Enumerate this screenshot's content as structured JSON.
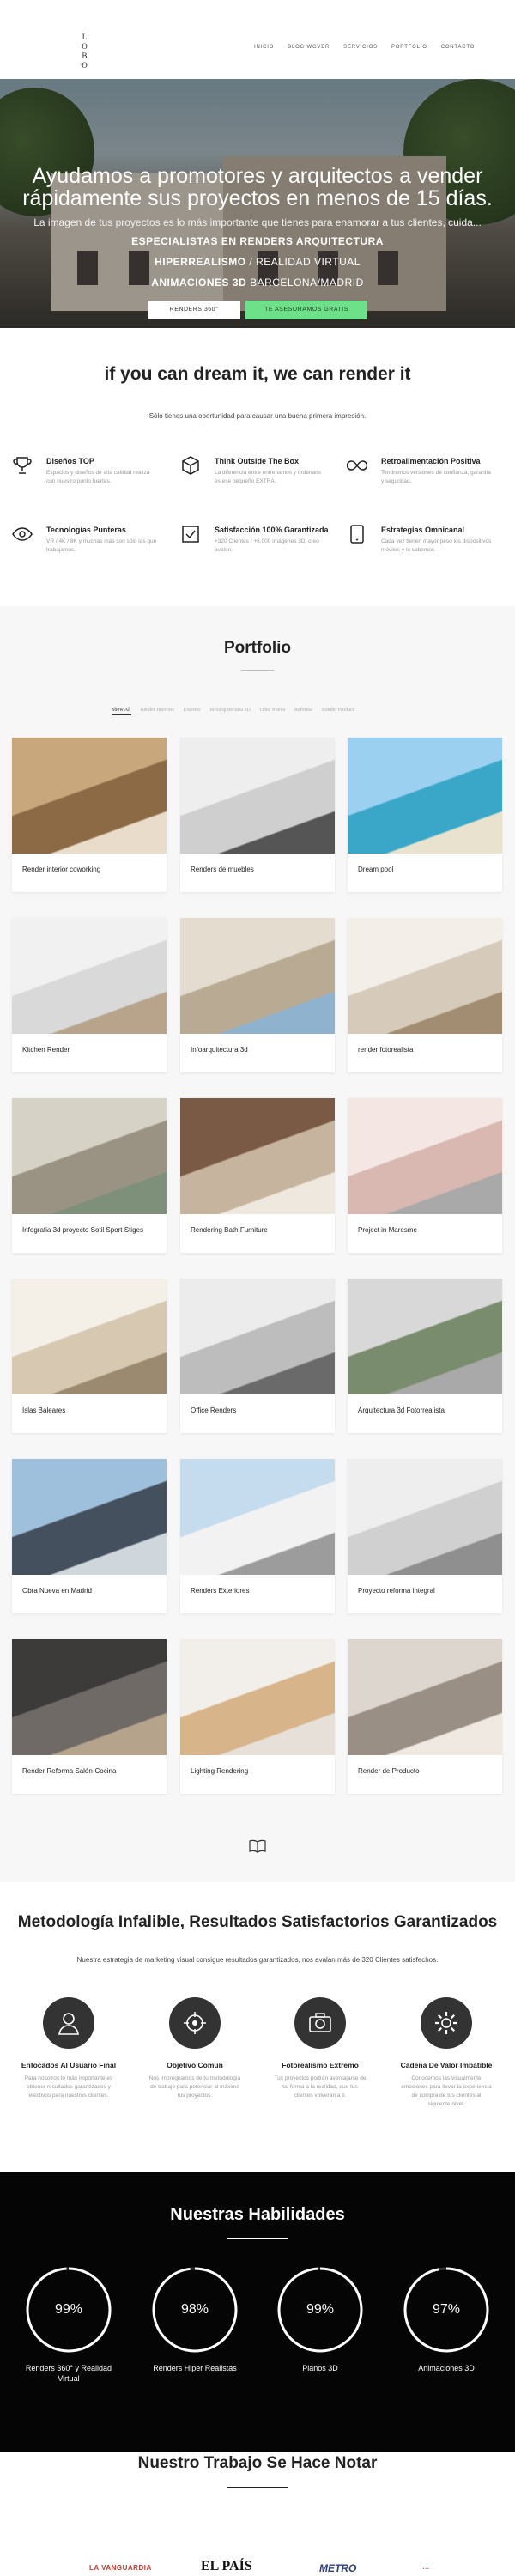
{
  "header": {
    "logo_line1": "L O",
    "logo_line2": "B O",
    "logo_sub": "3D",
    "nav": [
      "INICIO",
      "BLOG WGVER",
      "SERVICIOS",
      "PORTFOLIO",
      "CONTACTO"
    ]
  },
  "hero": {
    "title_line1": "Ayudamos a promotores y arquitectos a vender",
    "title_line2": "rápidamente sus proyectos en menos de 15 días.",
    "subtitle": "La imagen de tus proyectos es lo más importante que tienes para enamorar a tus clientes, cuida...",
    "highlight1": "ESPECIALISTAS EN RENDERS ARQUITECTURA",
    "highlight2_bold": "HIPERREALISMO",
    "highlight2_rest": " / REALIDAD VIRTUAL",
    "highlight3_bold": "ANIMACIONES 3D",
    "highlight3_rest": "  BARCELONA/MADRID",
    "btn_primary": "RENDERS 360°",
    "btn_secondary": "TE ASESORAMOS GRATIS"
  },
  "dream": {
    "title": "if you can dream it, we can render it",
    "subtitle": "Sólo tienes una oportunidad para causar una buena primera impresión.",
    "features": [
      {
        "icon": "trophy-icon",
        "title": "Diseños TOP",
        "desc": "Espacios y diseños de alta calidad realiza con nuestro punto fuertes."
      },
      {
        "icon": "cube-icon",
        "title": "Think Outside The Box",
        "desc": "La diferencia entre entrenamos y ordenaris es ese pequeño EXTRA."
      },
      {
        "icon": "infinity-icon",
        "title": "Retroalimentación Positiva",
        "desc": "Tendremos versiones de confianza, garantía y seguridad."
      },
      {
        "icon": "eye-icon",
        "title": "Tecnologías Punteras",
        "desc": "VR / 4K / 8K y muchas más son sólo las que trabajamos."
      },
      {
        "icon": "check-icon",
        "title": "Satisfacción 100% Garantizada",
        "desc": "+320 Clientes / +6.000 imágenes 3D, creo avalan."
      },
      {
        "icon": "tablet-icon",
        "title": "Estrategias Omnicanal",
        "desc": "Cada vez tienen mayor peso los dispositivos móviles y lo sabemos."
      }
    ]
  },
  "portfolio": {
    "title": "Portfolio",
    "filters": [
      "Show All",
      "Render Interiors",
      "Exterior",
      "Infoarquitectura 3D",
      "Obra Nueva",
      "Reforma",
      "Render Product"
    ],
    "items": [
      {
        "caption": "Render interior coworking",
        "theme": "wood"
      },
      {
        "caption": "Renders de muebles",
        "theme": "office-white"
      },
      {
        "caption": "Dream pool",
        "theme": "pool"
      },
      {
        "caption": "Kitchen Render",
        "theme": "kitchen-white"
      },
      {
        "caption": "Infoarquitectura 3d",
        "theme": "facade"
      },
      {
        "caption": "render fotorealista",
        "theme": "living"
      },
      {
        "caption": "Infografia 3d proyecto Sotil Sport Stiges",
        "theme": "glass"
      },
      {
        "caption": "Rendering Bath Furniture",
        "theme": "bath"
      },
      {
        "caption": "Project in Maresme",
        "theme": "pink-living"
      },
      {
        "caption": "Islas Baleares",
        "theme": "dining"
      },
      {
        "caption": "Office Renders",
        "theme": "office-long"
      },
      {
        "caption": "Arquitectura 3d Fotorrealista",
        "theme": "tower"
      },
      {
        "caption": "Obra Nueva en Madrid",
        "theme": "block-blue"
      },
      {
        "caption": "Renders Exteriores",
        "theme": "block-white"
      },
      {
        "caption": "Proyecto reforma integral",
        "theme": "kitchen-grey"
      },
      {
        "caption": "Render Reforma Salón-Cocina",
        "theme": "dark-living"
      },
      {
        "caption": "Lighting Rendering",
        "theme": "lamp"
      },
      {
        "caption": "Render de Producto",
        "theme": "bedroom"
      }
    ]
  },
  "methodology": {
    "title": "Metodología Infalible, Resultados Satisfactorios Garantizados",
    "subtitle": "Nuestra estrategia de marketing visual consigue resultados garantizados, nos avalan más de 320 Clientes satisfechos.",
    "items": [
      {
        "icon": "user-icon",
        "title": "Enfocados Al Usuario Final",
        "desc": "Para nosotros lo más importante es obtener resultados garantizados y efectivos para nuestros clientes."
      },
      {
        "icon": "target-icon",
        "title": "Objetivo Común",
        "desc": "Nos impregnamos de tu metodología de trabajo para potenciar al máximo tus proyectos."
      },
      {
        "icon": "camera-icon",
        "title": "Fotorealismo Extremo",
        "desc": "Tus proyectos podrán aventajarse de tal forma a la realidad, que tus clientes volverán a ti."
      },
      {
        "icon": "cog-icon",
        "title": "Cadena De Valor Imbatible",
        "desc": "Conocemos las visualmente emociones para llevar la experiencia de compra de tus clientes al siguiente nivel."
      }
    ]
  },
  "skills": {
    "title": "Nuestras Habilidades",
    "items": [
      {
        "percent": 99,
        "label": "99%",
        "name": "Renders 360° y Realidad Virtual"
      },
      {
        "percent": 98,
        "label": "98%",
        "name": "Renders Hiper Realistas"
      },
      {
        "percent": 99,
        "label": "99%",
        "name": "Planos 3D"
      },
      {
        "percent": 97,
        "label": "97%",
        "name": "Animaciones 3D"
      }
    ]
  },
  "press": {
    "title": "Nuestro Trabajo Se Hace Notar",
    "logos": [
      "LA VANGUARDIA",
      "EL PAÍS",
      "METRO",
      "..."
    ]
  },
  "colors": {
    "accent_green": "#6fe08a",
    "dark_bg": "#050505",
    "icon_circle": "#333333"
  }
}
